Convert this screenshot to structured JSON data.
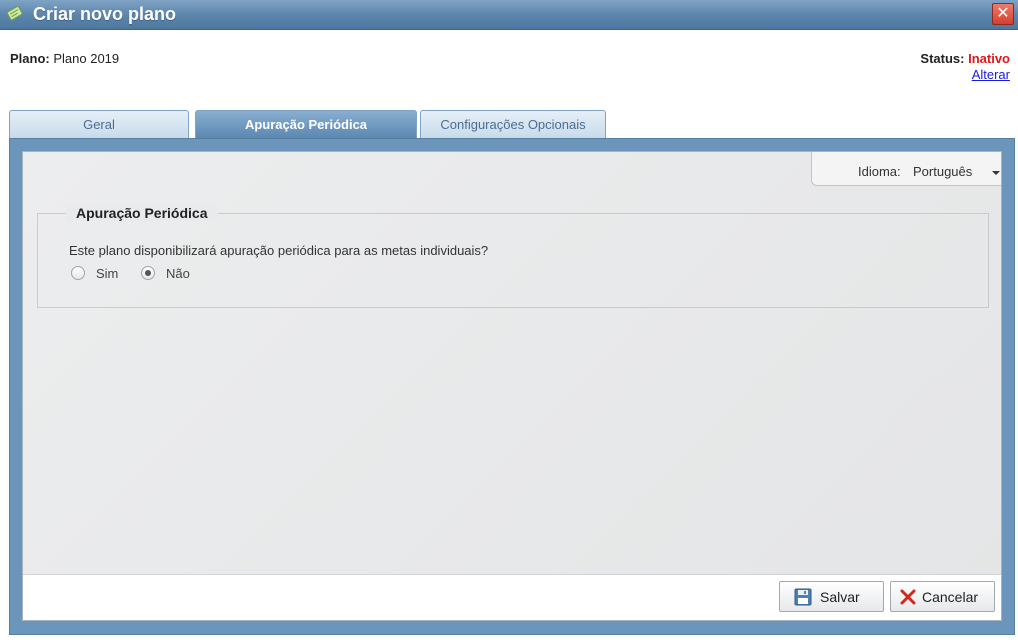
{
  "window": {
    "title": "Criar novo plano",
    "close_label": "✕"
  },
  "info": {
    "plan_label": "Plano:",
    "plan_value": "Plano 2019",
    "status_label": "Status:",
    "status_value": "Inativo",
    "status_color": "#e3141a",
    "change_link": "Alterar"
  },
  "tabs": [
    {
      "label": "Geral",
      "active": false
    },
    {
      "label": "Apuração Periódica",
      "active": true
    },
    {
      "label": "Configurações Opcionais",
      "active": false
    }
  ],
  "language": {
    "label": "Idioma:",
    "value": "Português"
  },
  "section": {
    "title": "Apuração Periódica",
    "question": "Este plano disponibilizará apuração periódica para as metas individuais?",
    "options": [
      {
        "label": "Sim",
        "checked": false
      },
      {
        "label": "Não",
        "checked": true
      }
    ]
  },
  "footer": {
    "save_label": "Salvar",
    "cancel_label": "Cancelar"
  },
  "colors": {
    "titlebar": "#5d86ad",
    "frame": "#6c95bc",
    "active_tab": "#5b88b2",
    "link": "#1a1adf"
  }
}
